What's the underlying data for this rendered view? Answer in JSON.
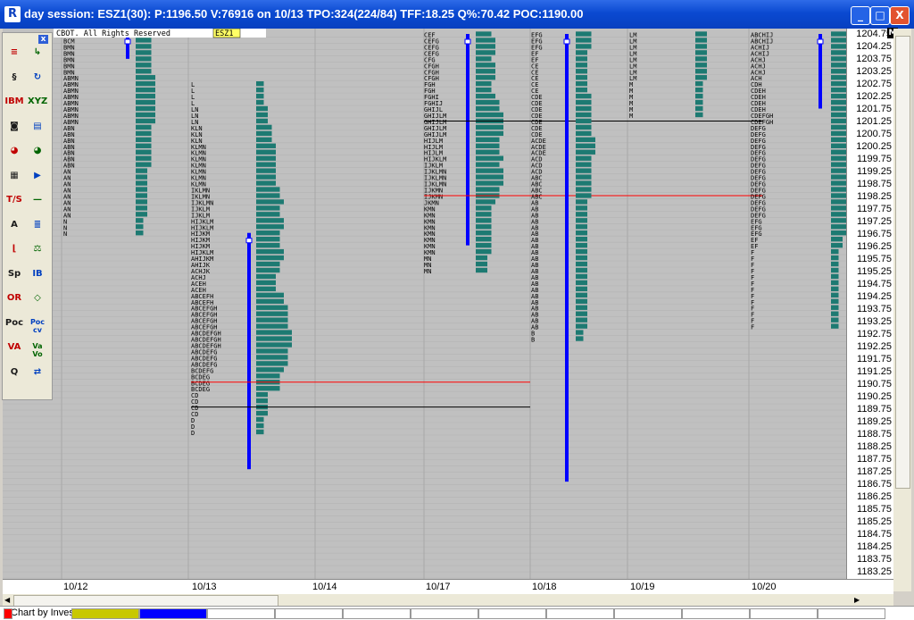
{
  "window": {
    "title": "day session: ESZ1(30): P:1196.50 V:76916 on 10/13 TPO:324(224/84) TFF:18.25 Q%:70.42 POC:1190.00",
    "app_icon": "market-profile-app-icon",
    "minimize": "_",
    "maximize": "□",
    "close": "X"
  },
  "chart": {
    "copyright": "CBOT. All Rights Reserved",
    "symbol_tag": "ESZ1",
    "axis_marker": "M",
    "price_labels": [
      "1204.75",
      "1204.25",
      "1203.75",
      "1203.25",
      "1202.75",
      "1202.25",
      "1201.75",
      "1201.25",
      "1200.75",
      "1200.25",
      "1199.75",
      "1199.25",
      "1198.75",
      "1198.25",
      "1197.75",
      "1197.25",
      "1196.75",
      "1196.25",
      "1195.75",
      "1195.25",
      "1194.75",
      "1194.25",
      "1193.75",
      "1193.25",
      "1192.75",
      "1192.25",
      "1191.75",
      "1191.25",
      "1190.75",
      "1190.25",
      "1189.75",
      "1189.25",
      "1188.75",
      "1188.25",
      "1187.75",
      "1187.25",
      "1186.75",
      "1186.25",
      "1185.75",
      "1185.25",
      "1184.75",
      "1184.25",
      "1183.75",
      "1183.25"
    ],
    "dates": [
      "10/12",
      "10/13",
      "10/14",
      "10/17",
      "10/18",
      "10/19",
      "10/20"
    ],
    "colors": {
      "background": "#c0c0c0",
      "histogram": "#1d7a72",
      "value_area": "#0000ff",
      "poc_line": "#ff0000",
      "reference_line": "#000000"
    }
  },
  "profiles": [
    {
      "date": "10/12",
      "top": "1204.75",
      "letters": [
        "BCM",
        "BCM",
        "BMN",
        "BMN",
        "BMN",
        "BMN",
        "BMN",
        "ABMN",
        "ABMN",
        "ABMN",
        "ABMN",
        "ABMN",
        "ABMN",
        "ABMN",
        "ABMN",
        "ABN",
        "ABN",
        "ABN",
        "ABN",
        "ABN",
        "ABN",
        "ABN",
        "AN",
        "AN",
        "AN",
        "AN",
        "AN",
        "AN",
        "AN",
        "AN",
        "N",
        "N",
        "N"
      ]
    },
    {
      "date": "10/13",
      "top": "1202.75",
      "letters": [
        "L",
        "L",
        "L",
        "L",
        "LN",
        "LN",
        "LN",
        "KLN",
        "KLN",
        "KLN",
        "KLMN",
        "KLMN",
        "KLMN",
        "KLMN",
        "KLMN",
        "KLMN",
        "KLMN",
        "IKLMN",
        "IKLMN",
        "IJKLMN",
        "IJKLM",
        "IJKLM",
        "HIJKLM",
        "HIJKLM",
        "HIJKM",
        "HIJKM",
        "HIJKM",
        "HIJKLM",
        "AHIJKM",
        "AHIJK",
        "ACHJK",
        "ACHJ",
        "ACEH",
        "ACEH",
        "ABCEFH",
        "ABCEFH",
        "ABCEFGH",
        "ABCEFGH",
        "ABCEFGH",
        "ABCEFGH",
        "ABCDEFGH",
        "ABCDEFGH",
        "ABCDEFGH",
        "ABCDEFG",
        "ABCDEFG",
        "ABCDEFG",
        "BCDEFG",
        "BCDEG",
        "BCDEG",
        "BCDEG",
        "CD",
        "CD",
        "CD",
        "CD",
        "D",
        "D",
        "D"
      ]
    },
    {
      "date": "10/17",
      "top": "1204.75",
      "letters": [
        "CEF",
        "CEFG",
        "CEFG",
        "CEFG",
        "CFG",
        "CFGH",
        "CFGH",
        "CFGH",
        "FGH",
        "FGH",
        "FGHI",
        "FGHIJ",
        "GHIJL",
        "GHIJLM",
        "GHIJLM",
        "GHIJLM",
        "GHIJLM",
        "HIJLM",
        "HIJLM",
        "HIJLM",
        "HIJKLM",
        "IJKLM",
        "IJKLMN",
        "IJKLMN",
        "IJKLMN",
        "IJKMN",
        "IJKMN",
        "JKMN",
        "KMN",
        "KMN",
        "KMN",
        "KMN",
        "KMN",
        "KMN",
        "KMN",
        "KMN",
        "MN",
        "MN",
        "MN"
      ]
    },
    {
      "date": "10/18",
      "top": "1204.75",
      "letters": [
        "EFG",
        "EFG",
        "EFG",
        "EF",
        "EF",
        "CE",
        "CE",
        "CE",
        "CE",
        "CE",
        "CDE",
        "CDE",
        "CDE",
        "CDE",
        "CDE",
        "CDE",
        "CDE",
        "ACDE",
        "ACDE",
        "ACDE",
        "ACD",
        "ACD",
        "ACD",
        "ABC",
        "ABC",
        "ABC",
        "ABC",
        "AB",
        "AB",
        "AB",
        "AB",
        "AB",
        "AB",
        "AB",
        "AB",
        "AB",
        "AB",
        "AB",
        "AB",
        "AB",
        "AB",
        "AB",
        "AB",
        "AB",
        "AB",
        "AB",
        "AB",
        "AB",
        "B",
        "B"
      ]
    },
    {
      "date": "10/19",
      "top": "1204.75",
      "letters": [
        "LM",
        "LM",
        "LM",
        "LM",
        "LM",
        "LM",
        "LM",
        "LM",
        "M",
        "M",
        "M",
        "M",
        "M",
        "M"
      ]
    },
    {
      "date": "10/20",
      "top": "1204.75",
      "letters": [
        "ABCHIJ",
        "ABCHIJ",
        "ACHIJ",
        "ACHIJ",
        "ACHJ",
        "ACHJ",
        "ACHJ",
        "ACH",
        "CDH",
        "CDEH",
        "CDEH",
        "CDEH",
        "CDEH",
        "CDEFGH",
        "CDEFGH",
        "DEFG",
        "DEFG",
        "DEFG",
        "DEFG",
        "DEFG",
        "DEFG",
        "DEFG",
        "DEFG",
        "DEFG",
        "DEFG",
        "DEFG",
        "DEFG",
        "DEFG",
        "DEFG",
        "DEFG",
        "EFG",
        "EFG",
        "EFG",
        "EF",
        "EF",
        "F",
        "F",
        "F",
        "F",
        "F",
        "F",
        "F",
        "F",
        "F",
        "F",
        "F",
        "F",
        "F"
      ]
    }
  ],
  "toolbar": {
    "close": "x",
    "tools": [
      {
        "icon": "settings-list-icon",
        "glyph": "≡"
      },
      {
        "icon": "export-arrow-icon",
        "glyph": "↳"
      },
      {
        "icon": "scroll-icon",
        "glyph": "§"
      },
      {
        "icon": "refresh-icon",
        "glyph": "↻"
      },
      {
        "icon": "ibm-symbol-icon",
        "glyph": "IBM"
      },
      {
        "icon": "xyz-icon",
        "glyph": "XYZ"
      },
      {
        "icon": "camera-icon",
        "glyph": "◙"
      },
      {
        "icon": "document-icon",
        "glyph": "▤"
      },
      {
        "icon": "color-wheel-icon",
        "glyph": "◕"
      },
      {
        "icon": "color-wheel-2-icon",
        "glyph": "◕"
      },
      {
        "icon": "grid-icon",
        "glyph": "▦"
      },
      {
        "icon": "play-icon",
        "glyph": "▶"
      },
      {
        "icon": "tpo-size-icon",
        "glyph": "T/S"
      },
      {
        "icon": "line-icon",
        "glyph": "—"
      },
      {
        "icon": "font-icon",
        "glyph": "A"
      },
      {
        "icon": "align-icon",
        "glyph": "≣"
      },
      {
        "icon": "bracket-icon",
        "glyph": "⌊"
      },
      {
        "icon": "balance-icon",
        "glyph": "⚖"
      },
      {
        "icon": "split-icon",
        "glyph": "Sp"
      },
      {
        "icon": "ib-icon",
        "glyph": "IB"
      },
      {
        "icon": "opening-range-icon",
        "glyph": "OR"
      },
      {
        "icon": "diamond-icon",
        "glyph": "◇"
      },
      {
        "icon": "poc-icon",
        "glyph": "Poc"
      },
      {
        "icon": "poc-cv-icon",
        "glyph": "Poc cv"
      },
      {
        "icon": "value-area-icon",
        "glyph": "VA"
      },
      {
        "icon": "va-vo-icon",
        "glyph": "Va Vo"
      },
      {
        "icon": "zoom-icon",
        "glyph": "Q"
      },
      {
        "icon": "move-icon",
        "glyph": "⇄"
      }
    ]
  },
  "status": {
    "text": "Chart by Investor/RT"
  },
  "swatches": [
    "#ff0000",
    "#c8c800",
    "#0000ff",
    "#ffffff",
    "#ffffff",
    "#ffffff",
    "#ffffff",
    "#ffffff",
    "#ffffff",
    "#ffffff",
    "#ffffff",
    "#ffffff",
    "#ffffff"
  ]
}
